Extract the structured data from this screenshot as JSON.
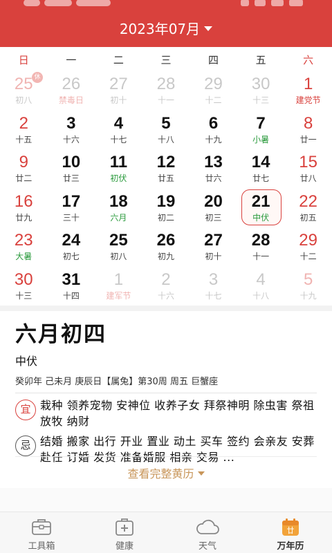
{
  "header": {
    "title": "2023年07月"
  },
  "weekdays": [
    "日",
    "一",
    "二",
    "三",
    "四",
    "五",
    "六"
  ],
  "calendar": {
    "rows": [
      [
        {
          "d": "25",
          "l": "初八",
          "badge": "休"
        },
        {
          "d": "26",
          "l": "禁毒日"
        },
        {
          "d": "27",
          "l": "初十"
        },
        {
          "d": "28",
          "l": "十一"
        },
        {
          "d": "29",
          "l": "十二"
        },
        {
          "d": "30",
          "l": "十三"
        },
        {
          "d": "1",
          "l": "建党节"
        }
      ],
      [
        {
          "d": "2",
          "l": "十五"
        },
        {
          "d": "3",
          "l": "十六"
        },
        {
          "d": "4",
          "l": "十七"
        },
        {
          "d": "5",
          "l": "十八"
        },
        {
          "d": "6",
          "l": "十九"
        },
        {
          "d": "7",
          "l": "小暑"
        },
        {
          "d": "8",
          "l": "廿一"
        }
      ],
      [
        {
          "d": "9",
          "l": "廿二"
        },
        {
          "d": "10",
          "l": "廿三"
        },
        {
          "d": "11",
          "l": "初伏"
        },
        {
          "d": "12",
          "l": "廿五"
        },
        {
          "d": "13",
          "l": "廿六"
        },
        {
          "d": "14",
          "l": "廿七"
        },
        {
          "d": "15",
          "l": "廿八"
        }
      ],
      [
        {
          "d": "16",
          "l": "廿九"
        },
        {
          "d": "17",
          "l": "三十"
        },
        {
          "d": "18",
          "l": "六月"
        },
        {
          "d": "19",
          "l": "初二"
        },
        {
          "d": "20",
          "l": "初三"
        },
        {
          "d": "21",
          "l": "中伏"
        },
        {
          "d": "22",
          "l": "初五"
        }
      ],
      [
        {
          "d": "23",
          "l": "大暑"
        },
        {
          "d": "24",
          "l": "初七"
        },
        {
          "d": "25",
          "l": "初八"
        },
        {
          "d": "26",
          "l": "初九"
        },
        {
          "d": "27",
          "l": "初十"
        },
        {
          "d": "28",
          "l": "十一"
        },
        {
          "d": "29",
          "l": "十二"
        }
      ],
      [
        {
          "d": "30",
          "l": "十三"
        },
        {
          "d": "31",
          "l": "十四"
        },
        {
          "d": "1",
          "l": "建军节"
        },
        {
          "d": "2",
          "l": "十六"
        },
        {
          "d": "3",
          "l": "十七"
        },
        {
          "d": "4",
          "l": "十八"
        },
        {
          "d": "5",
          "l": "十九"
        }
      ]
    ]
  },
  "almanac": {
    "lunar_date": "六月初四",
    "jieqi": "中伏",
    "ganzhi": "癸卯年 己未月 庚辰日【属兔】第30周 周五 巨蟹座",
    "yi_icon": "宜",
    "yi_text": "栽种 领养宠物 安神位 收养子女 拜祭神明 除虫害 祭祖 放牧 纳财",
    "ji_icon": "忌",
    "ji_text": "结婚 搬家 出行 开业 置业 动土 买车 签约 会亲友 安葬 赴任 订婚 发货 准备婚服 相亲 交易 ...",
    "more_label": "查看完整黄历"
  },
  "tabbar": [
    {
      "label": "工具箱",
      "icon": "toolbox-icon"
    },
    {
      "label": "健康",
      "icon": "medical-kit-icon"
    },
    {
      "label": "天气",
      "icon": "cloud-icon"
    },
    {
      "label": "万年历",
      "icon": "calendar-icon",
      "active": true
    }
  ],
  "colors": {
    "accent": "#d9413d",
    "weekend": "#d9413d",
    "term_green": "#2a9a3c",
    "link_gold": "#c8965a"
  }
}
